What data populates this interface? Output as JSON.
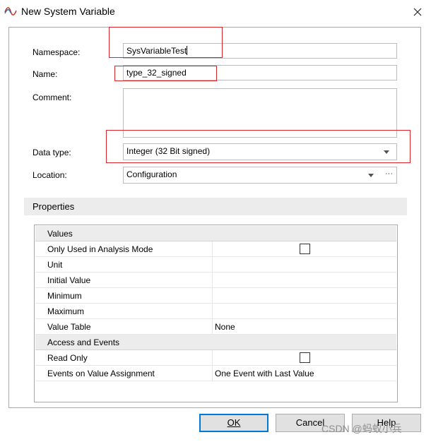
{
  "window": {
    "title": "New System Variable",
    "icon": "wave-icon",
    "close_icon": "close-icon"
  },
  "form": {
    "namespace_label": "Namespace:",
    "namespace_value": "SysVariableTest",
    "name_label": "Name:",
    "name_value": "type_32_signed",
    "comment_label": "Comment:",
    "comment_value": "",
    "datatype_label": "Data type:",
    "datatype_value": "Integer (32 Bit signed)",
    "location_label": "Location:",
    "location_value": "Configuration",
    "location_browse": "···"
  },
  "properties": {
    "header": "Properties",
    "categories": [
      {
        "name": "Values",
        "rows": [
          {
            "label": "Only Used in Analysis Mode",
            "value": "",
            "checkbox": true,
            "checked": false
          },
          {
            "label": "Unit",
            "value": ""
          },
          {
            "label": "Initial Value",
            "value": ""
          },
          {
            "label": "Minimum",
            "value": ""
          },
          {
            "label": "Maximum",
            "value": ""
          },
          {
            "label": "Value Table",
            "value": "None"
          }
        ]
      },
      {
        "name": "Access and Events",
        "rows": [
          {
            "label": "Read Only",
            "value": "",
            "checkbox": true,
            "checked": false
          },
          {
            "label": "Events on Value Assignment",
            "value": "One Event with Last Value"
          }
        ]
      }
    ]
  },
  "buttons": {
    "ok": "OK",
    "cancel": "Cancel",
    "help": "Help"
  },
  "watermark": "CSDN @蚂蚁小兵",
  "colors": {
    "highlight_box": "#d9262c",
    "focus_border": "#0078d7",
    "category_bg": "#ececec"
  }
}
